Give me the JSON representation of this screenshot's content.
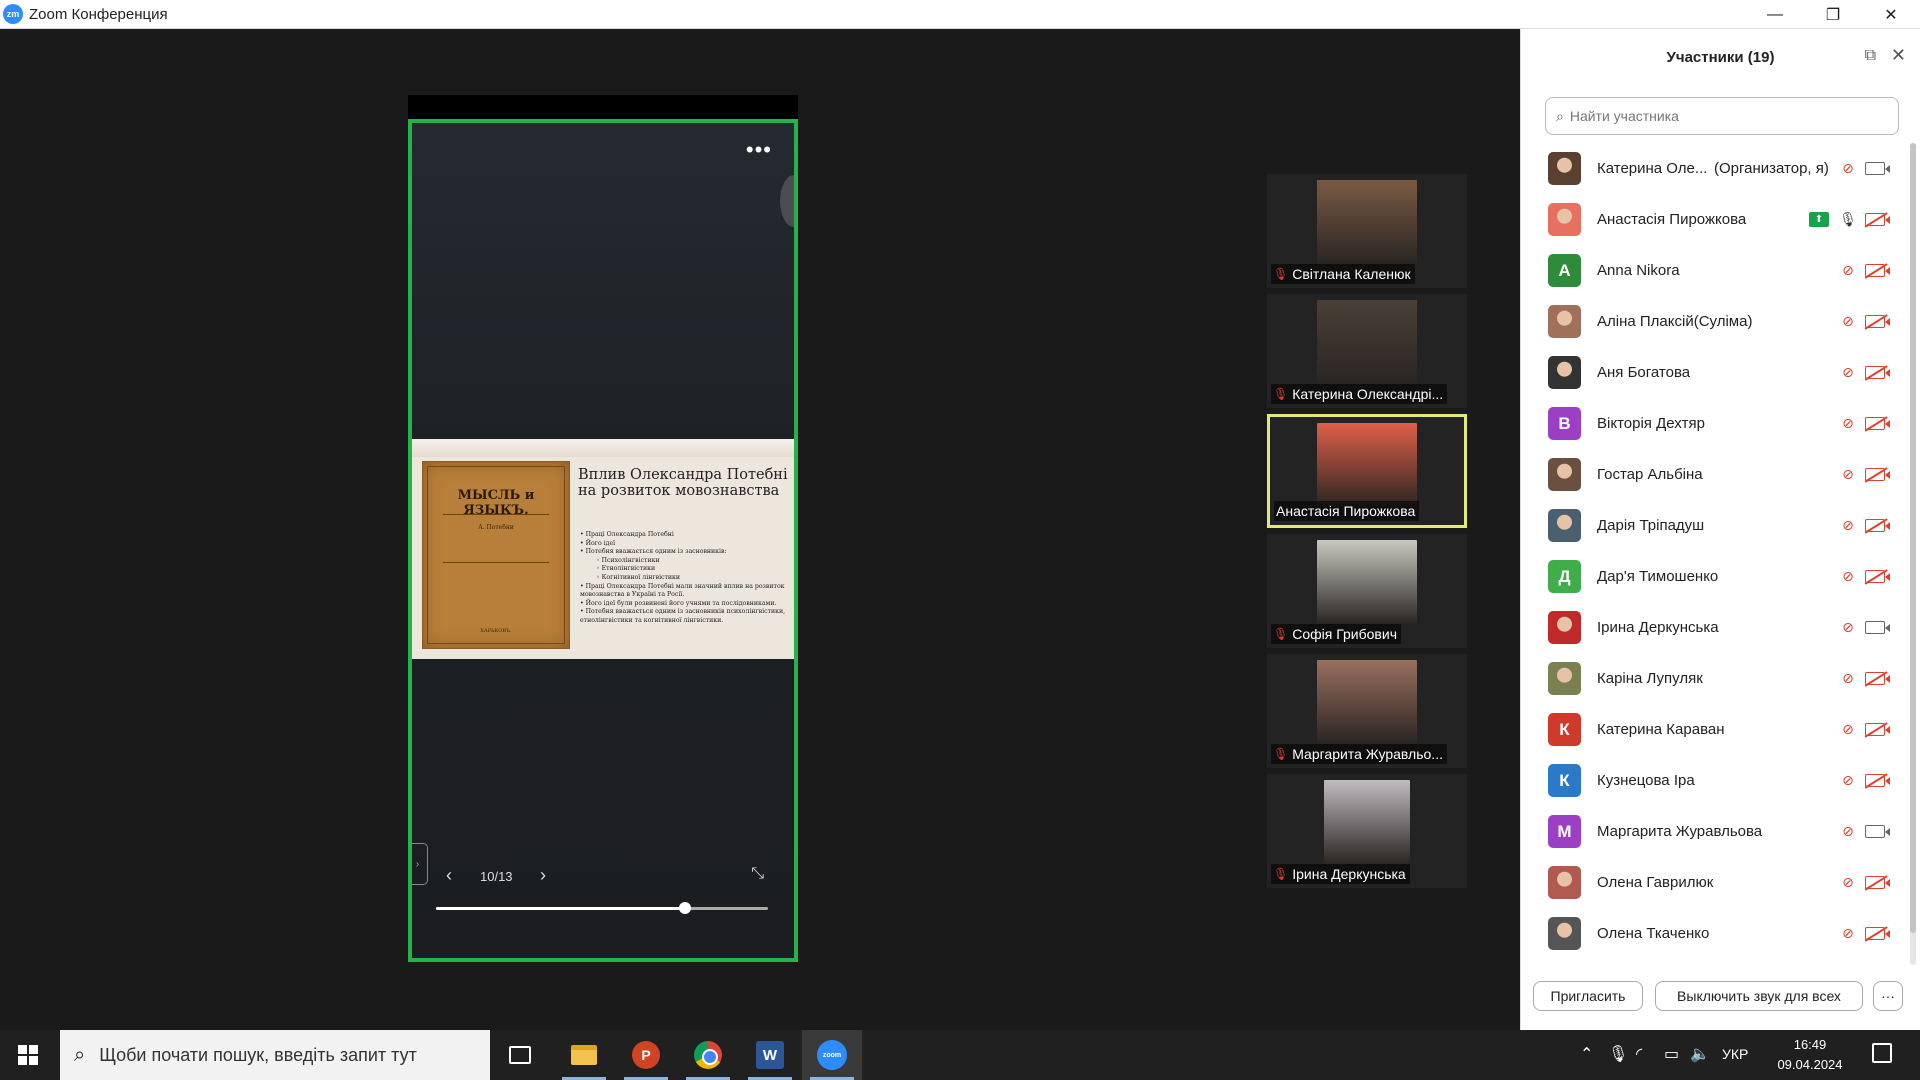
{
  "window": {
    "app_logo": "zm",
    "title": "Zoom Конференция",
    "minimize": "—",
    "maximize": "❐",
    "close": "✕"
  },
  "share": {
    "more": "•••",
    "page_counter": "10/13",
    "prev": "‹",
    "next": "›",
    "shrink": "⤡",
    "zoom_level": 0.75,
    "left_tab": "›"
  },
  "slide": {
    "book_title": "МЫСЛЬ и ЯЗЫКЪ.",
    "book_author": "А. Потебни",
    "book_edition": "ХАРЬКОВЪ.",
    "heading": "Вплив Олександра Потебні на розвиток мовознавства",
    "bullets": [
      "Праці Олександра Потебні",
      "Його ідеї",
      "Потебня вважається одним із засновників:"
    ],
    "sub_bullets": [
      "Психолінгвістики",
      "Етнолінгвістики",
      "Когнітивної лінгвістики"
    ],
    "bullets2": [
      "Праці Олександра Потебні мали значний вплив на розвиток мовознавства в Україні та Росії.",
      "Його ідеї були розвинені його учнями та послідовниками.",
      "Потебня вважається одним із засновників психолінгвістики, етнолінгвістики та когнітивної лінгвістики."
    ]
  },
  "gallery": [
    {
      "name": "Світлана Каленюк",
      "muted": true,
      "active": false,
      "photo_color": "#7a5a44"
    },
    {
      "name": "Катерина Олександрі...",
      "muted": true,
      "active": false,
      "photo_color": "#4a4038"
    },
    {
      "name": "Анастасія Пирожкова",
      "muted": false,
      "active": true,
      "photo_color": "#e0604a"
    },
    {
      "name": "Софія Грибович",
      "muted": true,
      "active": false,
      "photo_color": "#c8c9c0"
    },
    {
      "name": "Маргарита Журавльо...",
      "muted": true,
      "active": false,
      "photo_color": "#9a7060"
    },
    {
      "name": "Ірина Деркунська",
      "muted": true,
      "active": false,
      "photo_color": "#c0bcc0"
    }
  ],
  "participants_panel": {
    "title": "Участники (19)",
    "popout_icon": "⧉",
    "close_icon": "✕",
    "search_placeholder": "Найти участника",
    "items": [
      {
        "name": "Катерина Оле...",
        "role": "(Организатор, я)",
        "initial": "",
        "color": "#5a4030",
        "mic": "muted",
        "cam": "on",
        "sharing": false
      },
      {
        "name": "Анастасія Пирожкова",
        "role": "",
        "initial": "",
        "color": "#e87060",
        "mic": "on",
        "cam": "off",
        "sharing": true
      },
      {
        "name": "Anna Nikora",
        "role": "",
        "initial": "A",
        "color": "#2e8b3a",
        "mic": "muted",
        "cam": "off",
        "sharing": false
      },
      {
        "name": "Аліна Плаксій(Суліма)",
        "role": "",
        "initial": "",
        "color": "#a0705a",
        "mic": "muted",
        "cam": "off",
        "sharing": false
      },
      {
        "name": "Аня Богатова",
        "role": "",
        "initial": "",
        "color": "#333333",
        "mic": "muted",
        "cam": "off",
        "sharing": false
      },
      {
        "name": "Вікторія Дехтяр",
        "role": "",
        "initial": "B",
        "color": "#9b3fc5",
        "mic": "muted",
        "cam": "off",
        "sharing": false
      },
      {
        "name": "Гостар Альбіна",
        "role": "",
        "initial": "",
        "color": "#6a5040",
        "mic": "muted",
        "cam": "off",
        "sharing": false
      },
      {
        "name": "Дарія Тріпадуш",
        "role": "",
        "initial": "",
        "color": "#4a6070",
        "mic": "muted",
        "cam": "off",
        "sharing": false
      },
      {
        "name": "Дар'я Тимошенко",
        "role": "",
        "initial": "Д",
        "color": "#3fae4a",
        "mic": "muted",
        "cam": "off",
        "sharing": false
      },
      {
        "name": "Ірина Деркунська",
        "role": "",
        "initial": "",
        "color": "#c02a2a",
        "mic": "muted",
        "cam": "on",
        "sharing": false
      },
      {
        "name": "Каріна Лупуляк",
        "role": "",
        "initial": "",
        "color": "#7a8050",
        "mic": "muted",
        "cam": "off",
        "sharing": false
      },
      {
        "name": "Катерина Караван",
        "role": "",
        "initial": "К",
        "color": "#d03a2a",
        "mic": "muted",
        "cam": "off",
        "sharing": false
      },
      {
        "name": "Кузнецова Іра",
        "role": "",
        "initial": "К",
        "color": "#2a7ac8",
        "mic": "muted",
        "cam": "off",
        "sharing": false
      },
      {
        "name": "Маргарита Журавльова",
        "role": "",
        "initial": "M",
        "color": "#9b3fc5",
        "mic": "muted",
        "cam": "on",
        "sharing": false
      },
      {
        "name": "Олена Гаврилюк",
        "role": "",
        "initial": "",
        "color": "#b05a50",
        "mic": "muted",
        "cam": "off",
        "sharing": false
      },
      {
        "name": "Олена Ткаченко",
        "role": "",
        "initial": "",
        "color": "#555555",
        "mic": "muted",
        "cam": "off",
        "sharing": false
      }
    ],
    "invite_label": "Пригласить",
    "mute_all_label": "Выключить звук для всех",
    "more_label": "···"
  },
  "taskbar": {
    "search_placeholder": "Щоби почати пошук, введіть запит тут",
    "search_icon": "⌕",
    "ppt_label": "P",
    "word_label": "W",
    "zoom_label": "zoom",
    "lang": "УКР",
    "time": "16:49",
    "date": "09.04.2024",
    "tray_chevron": "⌃",
    "tray_mic": "🎙",
    "tray_wifi": "◜",
    "tray_battery": "▭",
    "tray_volume": "🔈"
  }
}
